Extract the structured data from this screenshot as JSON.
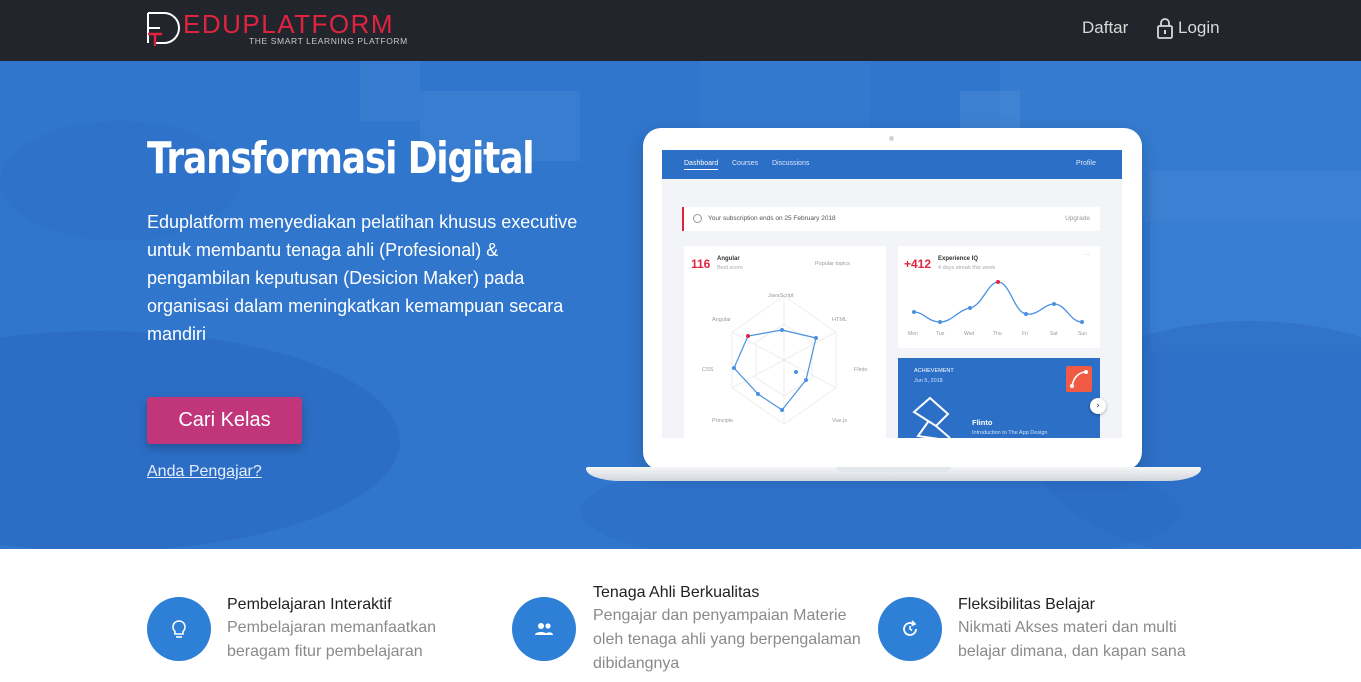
{
  "colors": {
    "navbar_bg": "#22252b",
    "brand_red": "#e0243f",
    "hero_blue": "#2f76cd",
    "button_pink": "#c1357b",
    "feature_icon_blue": "#2e80d6"
  },
  "navbar": {
    "logo_text_part1": "ED",
    "logo_text_part2": "UPLATFORM",
    "logo_tagline": "THE SMART LEARNING PLATFORM",
    "daftar_label": "Daftar",
    "login_label": "Login",
    "login_icon": "lock-icon"
  },
  "hero": {
    "title": "Transformasi Digital",
    "description": "Eduplatform menyediakan pelatihan khusus executive untuk membantu tenaga ahli (Profesional) & pengambilan keputusan (Desicion Maker) pada organisasi dalam meningkatkan kemampuan secara mandiri",
    "cta_label": "Cari Kelas",
    "teacher_link": "Anda Pengajar?"
  },
  "mockup": {
    "tabs": [
      "Dashboard",
      "Courses",
      "Discussions"
    ],
    "profile": "Profile",
    "notice": "Your subscription ends on 25 February 2018",
    "upgrade": "Upgrade",
    "skill_card": {
      "score": "116",
      "name": "Angular",
      "sub": "Best score",
      "filter": "Popular topics",
      "radar_labels": [
        "JavaScript",
        "HTML",
        "Flinto",
        "Vue.js",
        "Principle",
        "CSS",
        "Angular"
      ]
    },
    "iq_card": {
      "score": "+412",
      "name": "Experience IQ",
      "sub": "4 days streak this week",
      "days": [
        "Mon",
        "Tue",
        "Wed",
        "Thu",
        "Fri",
        "Sat",
        "Sun"
      ]
    },
    "achievement": {
      "label": "ACHIEVEMENT",
      "date": "Jun 5, 2018",
      "name": "Flinto",
      "desc": "Introduction to The App Design"
    }
  },
  "features": [
    {
      "icon": "lightbulb-icon",
      "title": "Pembelajaran Interaktif",
      "desc": "Pembelajaran memanfaatkan beragam fitur pembelajaran"
    },
    {
      "icon": "people-icon",
      "title": "Tenaga Ahli Berkualitas",
      "desc": "Pengajar dan penyampaian Materie oleh tenaga ahli yang berpengalaman dibidangnya"
    },
    {
      "icon": "refresh-clock-icon",
      "title": "Fleksibilitas Belajar",
      "desc": "Nikmati Akses materi dan multi belajar dimana, dan kapan sana"
    }
  ]
}
